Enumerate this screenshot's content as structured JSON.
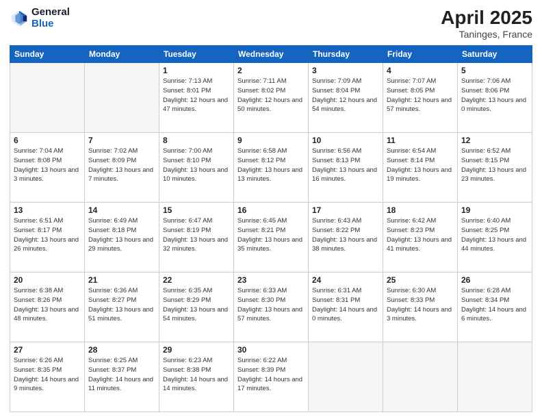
{
  "header": {
    "logo_general": "General",
    "logo_blue": "Blue",
    "title": "April 2025",
    "location": "Taninges, France"
  },
  "days_of_week": [
    "Sunday",
    "Monday",
    "Tuesday",
    "Wednesday",
    "Thursday",
    "Friday",
    "Saturday"
  ],
  "weeks": [
    [
      {
        "day": "",
        "empty": true
      },
      {
        "day": "",
        "empty": true
      },
      {
        "day": "1",
        "sunrise": "7:13 AM",
        "sunset": "8:01 PM",
        "daylight": "12 hours and 47 minutes."
      },
      {
        "day": "2",
        "sunrise": "7:11 AM",
        "sunset": "8:02 PM",
        "daylight": "12 hours and 50 minutes."
      },
      {
        "day": "3",
        "sunrise": "7:09 AM",
        "sunset": "8:04 PM",
        "daylight": "12 hours and 54 minutes."
      },
      {
        "day": "4",
        "sunrise": "7:07 AM",
        "sunset": "8:05 PM",
        "daylight": "12 hours and 57 minutes."
      },
      {
        "day": "5",
        "sunrise": "7:06 AM",
        "sunset": "8:06 PM",
        "daylight": "13 hours and 0 minutes."
      }
    ],
    [
      {
        "day": "6",
        "sunrise": "7:04 AM",
        "sunset": "8:08 PM",
        "daylight": "13 hours and 3 minutes."
      },
      {
        "day": "7",
        "sunrise": "7:02 AM",
        "sunset": "8:09 PM",
        "daylight": "13 hours and 7 minutes."
      },
      {
        "day": "8",
        "sunrise": "7:00 AM",
        "sunset": "8:10 PM",
        "daylight": "13 hours and 10 minutes."
      },
      {
        "day": "9",
        "sunrise": "6:58 AM",
        "sunset": "8:12 PM",
        "daylight": "13 hours and 13 minutes."
      },
      {
        "day": "10",
        "sunrise": "6:56 AM",
        "sunset": "8:13 PM",
        "daylight": "13 hours and 16 minutes."
      },
      {
        "day": "11",
        "sunrise": "6:54 AM",
        "sunset": "8:14 PM",
        "daylight": "13 hours and 19 minutes."
      },
      {
        "day": "12",
        "sunrise": "6:52 AM",
        "sunset": "8:15 PM",
        "daylight": "13 hours and 23 minutes."
      }
    ],
    [
      {
        "day": "13",
        "sunrise": "6:51 AM",
        "sunset": "8:17 PM",
        "daylight": "13 hours and 26 minutes."
      },
      {
        "day": "14",
        "sunrise": "6:49 AM",
        "sunset": "8:18 PM",
        "daylight": "13 hours and 29 minutes."
      },
      {
        "day": "15",
        "sunrise": "6:47 AM",
        "sunset": "8:19 PM",
        "daylight": "13 hours and 32 minutes."
      },
      {
        "day": "16",
        "sunrise": "6:45 AM",
        "sunset": "8:21 PM",
        "daylight": "13 hours and 35 minutes."
      },
      {
        "day": "17",
        "sunrise": "6:43 AM",
        "sunset": "8:22 PM",
        "daylight": "13 hours and 38 minutes."
      },
      {
        "day": "18",
        "sunrise": "6:42 AM",
        "sunset": "8:23 PM",
        "daylight": "13 hours and 41 minutes."
      },
      {
        "day": "19",
        "sunrise": "6:40 AM",
        "sunset": "8:25 PM",
        "daylight": "13 hours and 44 minutes."
      }
    ],
    [
      {
        "day": "20",
        "sunrise": "6:38 AM",
        "sunset": "8:26 PM",
        "daylight": "13 hours and 48 minutes."
      },
      {
        "day": "21",
        "sunrise": "6:36 AM",
        "sunset": "8:27 PM",
        "daylight": "13 hours and 51 minutes."
      },
      {
        "day": "22",
        "sunrise": "6:35 AM",
        "sunset": "8:29 PM",
        "daylight": "13 hours and 54 minutes."
      },
      {
        "day": "23",
        "sunrise": "6:33 AM",
        "sunset": "8:30 PM",
        "daylight": "13 hours and 57 minutes."
      },
      {
        "day": "24",
        "sunrise": "6:31 AM",
        "sunset": "8:31 PM",
        "daylight": "14 hours and 0 minutes."
      },
      {
        "day": "25",
        "sunrise": "6:30 AM",
        "sunset": "8:33 PM",
        "daylight": "14 hours and 3 minutes."
      },
      {
        "day": "26",
        "sunrise": "6:28 AM",
        "sunset": "8:34 PM",
        "daylight": "14 hours and 6 minutes."
      }
    ],
    [
      {
        "day": "27",
        "sunrise": "6:26 AM",
        "sunset": "8:35 PM",
        "daylight": "14 hours and 9 minutes."
      },
      {
        "day": "28",
        "sunrise": "6:25 AM",
        "sunset": "8:37 PM",
        "daylight": "14 hours and 11 minutes."
      },
      {
        "day": "29",
        "sunrise": "6:23 AM",
        "sunset": "8:38 PM",
        "daylight": "14 hours and 14 minutes."
      },
      {
        "day": "30",
        "sunrise": "6:22 AM",
        "sunset": "8:39 PM",
        "daylight": "14 hours and 17 minutes."
      },
      {
        "day": "",
        "empty": true
      },
      {
        "day": "",
        "empty": true
      },
      {
        "day": "",
        "empty": true
      }
    ]
  ]
}
